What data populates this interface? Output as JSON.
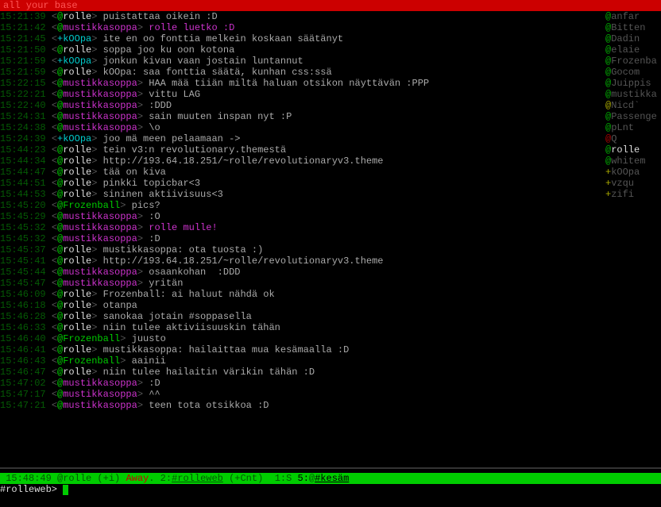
{
  "topic": "all your base",
  "messages": [
    {
      "ts": "15:21:39",
      "pre": "@",
      "preClass": "at-g",
      "nick": "rolle",
      "nickClass": "nick-w",
      "msg": "puistattaa oikein :D",
      "msgClass": "msg"
    },
    {
      "ts": "15:21:42",
      "pre": "@",
      "preClass": "at-g",
      "nick": "mustikkasoppa",
      "nickClass": "nick-m",
      "msg": "rolle luetko :D",
      "msgClass": "msg-m"
    },
    {
      "ts": "15:21:45",
      "pre": "+",
      "preClass": "plus-c",
      "nick": "kOOpa",
      "nickClass": "nick-c",
      "msg": "ite en oo fonttia melkein koskaan säätänyt",
      "msgClass": "msg"
    },
    {
      "ts": "15:21:50",
      "pre": "@",
      "preClass": "at-g",
      "nick": "rolle",
      "nickClass": "nick-w",
      "msg": "soppa joo ku oon kotona",
      "msgClass": "msg"
    },
    {
      "ts": "15:21:59",
      "pre": "+",
      "preClass": "plus-c",
      "nick": "kOOpa",
      "nickClass": "nick-c",
      "msg": "jonkun kivan vaan jostain luntannut",
      "msgClass": "msg"
    },
    {
      "ts": "15:21:59",
      "pre": "@",
      "preClass": "at-g",
      "nick": "rolle",
      "nickClass": "nick-w",
      "msg": "kOOpa: saa fonttia säätä, kunhan css:ssä",
      "msgClass": "msg"
    },
    {
      "ts": "15:22:15",
      "pre": "@",
      "preClass": "at-g",
      "nick": "mustikkasoppa",
      "nickClass": "nick-m",
      "msg": "HAA mää tiiän miltä haluan otsikon näyttävän :PPP",
      "msgClass": "msg"
    },
    {
      "ts": "15:22:21",
      "pre": "@",
      "preClass": "at-g",
      "nick": "mustikkasoppa",
      "nickClass": "nick-m",
      "msg": "vittu LAG",
      "msgClass": "msg"
    },
    {
      "ts": "15:22:40",
      "pre": "@",
      "preClass": "at-g",
      "nick": "mustikkasoppa",
      "nickClass": "nick-m",
      "msg": ":DDD",
      "msgClass": "msg"
    },
    {
      "ts": "15:24:31",
      "pre": "@",
      "preClass": "at-g",
      "nick": "mustikkasoppa",
      "nickClass": "nick-m",
      "msg": "sain muuten inspan nyt :P",
      "msgClass": "msg"
    },
    {
      "ts": "15:24:38",
      "pre": "@",
      "preClass": "at-g",
      "nick": "mustikkasoppa",
      "nickClass": "nick-m",
      "msg": "\\o",
      "msgClass": "msg"
    },
    {
      "ts": "15:24:39",
      "pre": "+",
      "preClass": "plus-c",
      "nick": "kOOpa",
      "nickClass": "nick-c",
      "msg": "joo mä meen pelaamaan ->",
      "msgClass": "msg"
    },
    {
      "ts": "15:44:23",
      "pre": "@",
      "preClass": "at-g",
      "nick": "rolle",
      "nickClass": "nick-w",
      "msg": "tein v3:n revolutionary.themestä",
      "msgClass": "msg"
    },
    {
      "ts": "15:44:34",
      "pre": "@",
      "preClass": "at-g",
      "nick": "rolle",
      "nickClass": "nick-w",
      "msg": "http://193.64.18.251/~rolle/revolutionaryv3.theme",
      "msgClass": "msg"
    },
    {
      "ts": "15:44:47",
      "pre": "@",
      "preClass": "at-g",
      "nick": "rolle",
      "nickClass": "nick-w",
      "msg": "tää on kiva",
      "msgClass": "msg"
    },
    {
      "ts": "15:44:51",
      "pre": "@",
      "preClass": "at-g",
      "nick": "rolle",
      "nickClass": "nick-w",
      "msg": "pinkki topicbar<3",
      "msgClass": "msg"
    },
    {
      "ts": "15:44:53",
      "pre": "@",
      "preClass": "at-g",
      "nick": "rolle",
      "nickClass": "nick-w",
      "msg": "sininen aktiivisuus<3",
      "msgClass": "msg"
    },
    {
      "ts": "15:45:20",
      "pre": "@",
      "preClass": "at-g",
      "nick": "Frozenball",
      "nickClass": "nick-g",
      "msg": "pics?",
      "msgClass": "msg"
    },
    {
      "ts": "15:45:29",
      "pre": "@",
      "preClass": "at-g",
      "nick": "mustikkasoppa",
      "nickClass": "nick-m",
      "msg": ":O",
      "msgClass": "msg"
    },
    {
      "ts": "15:45:32",
      "pre": "@",
      "preClass": "at-g",
      "nick": "mustikkasoppa",
      "nickClass": "nick-m",
      "msg": "rolle mulle!",
      "msgClass": "msg-m"
    },
    {
      "ts": "15:45:32",
      "pre": "@",
      "preClass": "at-g",
      "nick": "mustikkasoppa",
      "nickClass": "nick-m",
      "msg": ":D",
      "msgClass": "msg"
    },
    {
      "ts": "15:45:37",
      "pre": "@",
      "preClass": "at-g",
      "nick": "rolle",
      "nickClass": "nick-w",
      "msg": "mustikkasoppa: ota tuosta :)",
      "msgClass": "msg"
    },
    {
      "ts": "15:45:41",
      "pre": "@",
      "preClass": "at-g",
      "nick": "rolle",
      "nickClass": "nick-w",
      "msg": "http://193.64.18.251/~rolle/revolutionaryv3.theme",
      "msgClass": "msg"
    },
    {
      "ts": "15:45:44",
      "pre": "@",
      "preClass": "at-g",
      "nick": "mustikkasoppa",
      "nickClass": "nick-m",
      "msg": "osaankohan  :DDD",
      "msgClass": "msg"
    },
    {
      "ts": "15:45:47",
      "pre": "@",
      "preClass": "at-g",
      "nick": "mustikkasoppa",
      "nickClass": "nick-m",
      "msg": "yritän",
      "msgClass": "msg"
    },
    {
      "ts": "15:46:09",
      "pre": "@",
      "preClass": "at-g",
      "nick": "rolle",
      "nickClass": "nick-w",
      "msg": "Frozenball: ai haluut nähdä ok",
      "msgClass": "msg"
    },
    {
      "ts": "15:46:18",
      "pre": "@",
      "preClass": "at-g",
      "nick": "rolle",
      "nickClass": "nick-w",
      "msg": "otanpa",
      "msgClass": "msg"
    },
    {
      "ts": "15:46:28",
      "pre": "@",
      "preClass": "at-g",
      "nick": "rolle",
      "nickClass": "nick-w",
      "msg": "sanokaa jotain #soppasella",
      "msgClass": "msg"
    },
    {
      "ts": "15:46:33",
      "pre": "@",
      "preClass": "at-g",
      "nick": "rolle",
      "nickClass": "nick-w",
      "msg": "niin tulee aktiviisuuskin tähän",
      "msgClass": "msg"
    },
    {
      "ts": "15:46:40",
      "pre": "@",
      "preClass": "at-g",
      "nick": "Frozenball",
      "nickClass": "nick-g",
      "msg": "juusto",
      "msgClass": "msg"
    },
    {
      "ts": "15:46:41",
      "pre": "@",
      "preClass": "at-g",
      "nick": "rolle",
      "nickClass": "nick-w",
      "msg": "mustikkasoppa: hailaittaa mua kesämaalla :D",
      "msgClass": "msg"
    },
    {
      "ts": "15:46:43",
      "pre": "@",
      "preClass": "at-g",
      "nick": "Frozenball",
      "nickClass": "nick-g",
      "msg": "aainii",
      "msgClass": "msg"
    },
    {
      "ts": "15:46:47",
      "pre": "@",
      "preClass": "at-g",
      "nick": "rolle",
      "nickClass": "nick-w",
      "msg": "niin tulee hailaitin värikin tähän :D",
      "msgClass": "msg"
    },
    {
      "ts": "15:47:02",
      "pre": "@",
      "preClass": "at-g",
      "nick": "mustikkasoppa",
      "nickClass": "nick-m",
      "msg": ":D",
      "msgClass": "msg"
    },
    {
      "ts": "15:47:17",
      "pre": "@",
      "preClass": "at-g",
      "nick": "mustikkasoppa",
      "nickClass": "nick-m",
      "msg": "^^",
      "msgClass": "msg"
    },
    {
      "ts": "15:47:21",
      "pre": "@",
      "preClass": "at-g",
      "nick": "mustikkasoppa",
      "nickClass": "nick-m",
      "msg": "teen tota otsikkoa :D",
      "msgClass": "msg"
    }
  ],
  "nicklist": [
    {
      "pre": "@",
      "preClass": "nl-at-g",
      "nick": "anfar",
      "nickClass": "nl-nick"
    },
    {
      "pre": "@",
      "preClass": "nl-at-g",
      "nick": "Bitten",
      "nickClass": "nl-nick"
    },
    {
      "pre": "@",
      "preClass": "nl-at-g",
      "nick": "Dadin",
      "nickClass": "nl-nick"
    },
    {
      "pre": "@",
      "preClass": "nl-at-g",
      "nick": "elaie",
      "nickClass": "nl-nick"
    },
    {
      "pre": "@",
      "preClass": "nl-at-g",
      "nick": "Frozenba",
      "nickClass": "nl-nick"
    },
    {
      "pre": "@",
      "preClass": "nl-at-g",
      "nick": "Gocom",
      "nickClass": "nl-nick"
    },
    {
      "pre": "@",
      "preClass": "nl-at-g",
      "nick": "Juippis",
      "nickClass": "nl-nick"
    },
    {
      "pre": "@",
      "preClass": "nl-at-g",
      "nick": "mustikka",
      "nickClass": "nl-nick"
    },
    {
      "pre": "@",
      "preClass": "nl-at-y",
      "nick": "Nicd`",
      "nickClass": "nl-nick"
    },
    {
      "pre": "@",
      "preClass": "nl-at-g",
      "nick": "Passenge",
      "nickClass": "nl-nick"
    },
    {
      "pre": "@",
      "preClass": "nl-at-g",
      "nick": "pLnt",
      "nickClass": "nl-nick"
    },
    {
      "pre": "@",
      "preClass": "nl-at-r",
      "nick": "Q",
      "nickClass": "nl-nick"
    },
    {
      "pre": "@",
      "preClass": "nl-at-g",
      "nick": "rolle",
      "nickClass": "nl-self"
    },
    {
      "pre": "@",
      "preClass": "nl-at-g",
      "nick": "whitem",
      "nickClass": "nl-nick"
    },
    {
      "pre": "+",
      "preClass": "nl-plus-y",
      "nick": "kOOpa",
      "nickClass": "nl-nick"
    },
    {
      "pre": "+",
      "preClass": "nl-plus-y",
      "nick": "vzqu",
      "nickClass": "nl-nick"
    },
    {
      "pre": "+",
      "preClass": "nl-plus-y",
      "nick": "zifi",
      "nickClass": "nl-nick"
    }
  ],
  "status": {
    "time": " 15:48:49",
    "nick": " @rolle (+i) ",
    "away": "Away",
    "dot": ". ",
    "ch2_a": "2:",
    "ch2_b": "#rolleweb",
    "ch2_c": " (+Cnt)  ",
    "srv": "1:S ",
    "act_a": "5:",
    "act_b": "@",
    "act_c": "#kesäm",
    "tail": "                                    "
  },
  "input": {
    "prompt": "#rolleweb>"
  }
}
